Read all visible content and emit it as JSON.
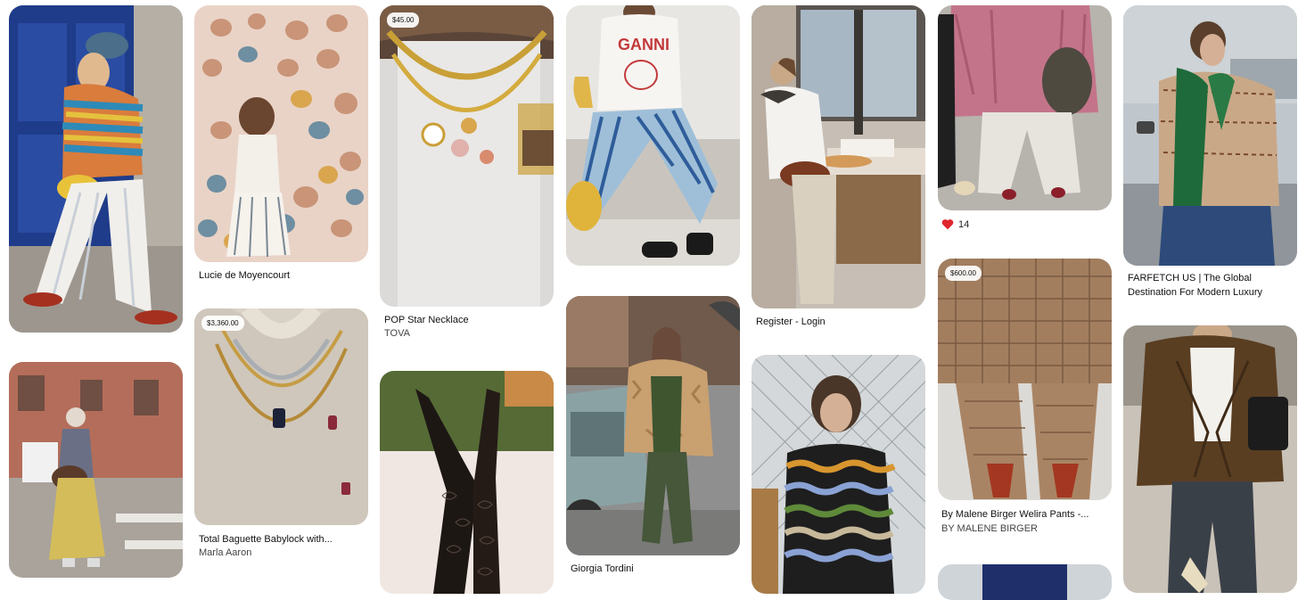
{
  "pins": [
    {
      "id": "crochet-sweater"
    },
    {
      "id": "grey-hair-street"
    },
    {
      "id": "shell-wall",
      "title": "Lucie de Moyencourt"
    },
    {
      "id": "gold-necklace-layers",
      "price": "$3,360.00",
      "title": "Total Baguette Babylock with...",
      "subtitle": "Marla Aaron"
    },
    {
      "id": "pop-star-necklace",
      "price": "$45.00",
      "title": "POP Star Necklace",
      "subtitle": "TOVA"
    },
    {
      "id": "lace-tights"
    },
    {
      "id": "ganni-tee"
    },
    {
      "id": "fur-coat",
      "title": "Giorgia Tordini"
    },
    {
      "id": "bakery-window",
      "title": "Register - Login"
    },
    {
      "id": "wavy-knit"
    },
    {
      "id": "pink-jacket",
      "reaction": {
        "icon": "heart-icon",
        "count": "14"
      }
    },
    {
      "id": "crochet-pants",
      "price": "$600.00",
      "title": "By Malene Birger Welira Pants -...",
      "subtitle": "BY MALENE BIRGER"
    },
    {
      "id": "blue-partial"
    },
    {
      "id": "green-scarf",
      "title": "FARFETCH US | The Global",
      "subtitle": "Destination For Modern Luxury"
    },
    {
      "id": "brown-blazer"
    }
  ]
}
